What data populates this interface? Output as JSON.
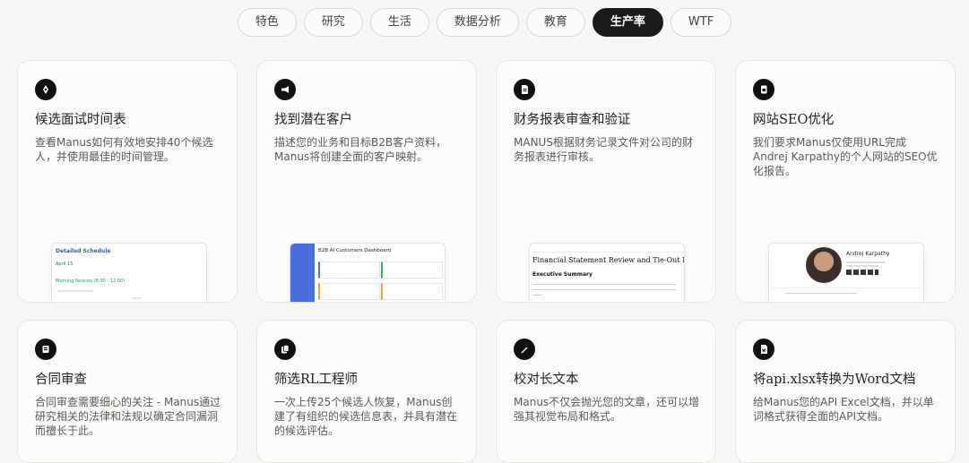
{
  "tabs": [
    {
      "label": "特色",
      "active": false
    },
    {
      "label": "研究",
      "active": false
    },
    {
      "label": "生活",
      "active": false
    },
    {
      "label": "数据分析",
      "active": false
    },
    {
      "label": "教育",
      "active": false
    },
    {
      "label": "生产率",
      "active": true
    },
    {
      "label": "WTF",
      "active": false
    }
  ],
  "cards": [
    {
      "title": "候选面试时间表",
      "desc": "查看Manus如何有效地安排40个候选人，并使用最佳的时间管理。",
      "icon": "compass-icon",
      "preview": {
        "heading": "Detailed Schedule",
        "date": "April 15",
        "session": "Morning Session (8:30 - 12:00)"
      }
    },
    {
      "title": "找到潜在客户",
      "desc": "描述您的业务和目标B2B客户资料，Manus将创建全面的客户映射。",
      "icon": "megaphone-icon",
      "preview": {
        "heading": "B2B AI Customers Dashboard"
      }
    },
    {
      "title": "财务报表审查和验证",
      "desc": "MANUS根据财务记录文件对公司的财务报表进行审核。",
      "icon": "document-icon",
      "preview": {
        "heading": "Financial Statement Review and Tie-Out Report",
        "subheading": "Executive Summary"
      }
    },
    {
      "title": "网站SEO优化",
      "desc": "我们要求Manus仅使用URL完成Andrej Karpathy的个人网站的SEO优化报告。",
      "icon": "page-icon",
      "preview": {
        "name": "Andrej Karpathy"
      }
    },
    {
      "title": "合同审查",
      "desc": "合同审查需要细心的关注 - Manus通过研究相关的法律和法规以确定合同漏洞而擅长于此。",
      "icon": "edit-icon"
    },
    {
      "title": "筛选RL工程师",
      "desc": "一次上传25个候选人恢复，Manus创建了有组织的候选信息表，并具有潜在的候选评估。",
      "icon": "files-icon"
    },
    {
      "title": "校对长文本",
      "desc": "Manus不仅会抛光您的文章，还可以增强其视觉布局和格式。",
      "icon": "pen-icon"
    },
    {
      "title": "将api.xlsx转换为Word文档",
      "desc": "给Manus您的API Excel文档，并以单词格式获得全面的API文档。",
      "icon": "word-doc-icon"
    }
  ]
}
